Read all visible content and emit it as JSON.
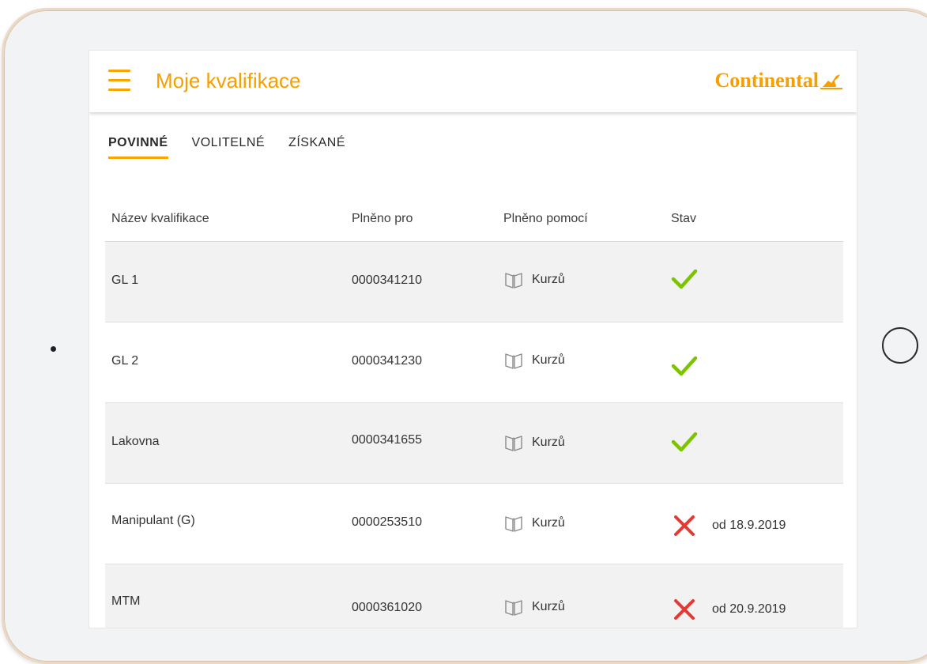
{
  "header": {
    "title": "Moje kvalifikace",
    "logo_text": "Continental"
  },
  "tabs": [
    {
      "label": "POVINNÉ",
      "active": true
    },
    {
      "label": "VOLITELNÉ",
      "active": false
    },
    {
      "label": "ZÍSKANÉ",
      "active": false
    }
  ],
  "table": {
    "columns": [
      "Název kvalifikace",
      "Plněno pro",
      "Plněno pomocí",
      "Stav"
    ],
    "rows": [
      {
        "name": "GL 1",
        "for": "0000341210",
        "via": "Kurzů",
        "status": "check-icon",
        "date": ""
      },
      {
        "name": "GL 2",
        "for": "0000341230",
        "via": "Kurzů",
        "status": "check-icon",
        "date": ""
      },
      {
        "name": "Lakovna",
        "for": "0000341655",
        "via": "Kurzů",
        "status": "check-icon",
        "date": ""
      },
      {
        "name": "Manipulant (G)",
        "for": "0000253510",
        "via": "Kurzů",
        "status": "cross-icon",
        "date": "od 18.9.2019"
      },
      {
        "name": "MTM",
        "for": "0000361020",
        "via": "Kurzů",
        "status": "cross-icon",
        "date": "od 20.9.2019"
      }
    ]
  },
  "colors": {
    "accent": "#f5a000",
    "success": "#7cc400",
    "error": "#e53935"
  },
  "icons": {
    "menu": "hamburger-icon",
    "via": "book-icon",
    "home": "home-button-icon"
  }
}
